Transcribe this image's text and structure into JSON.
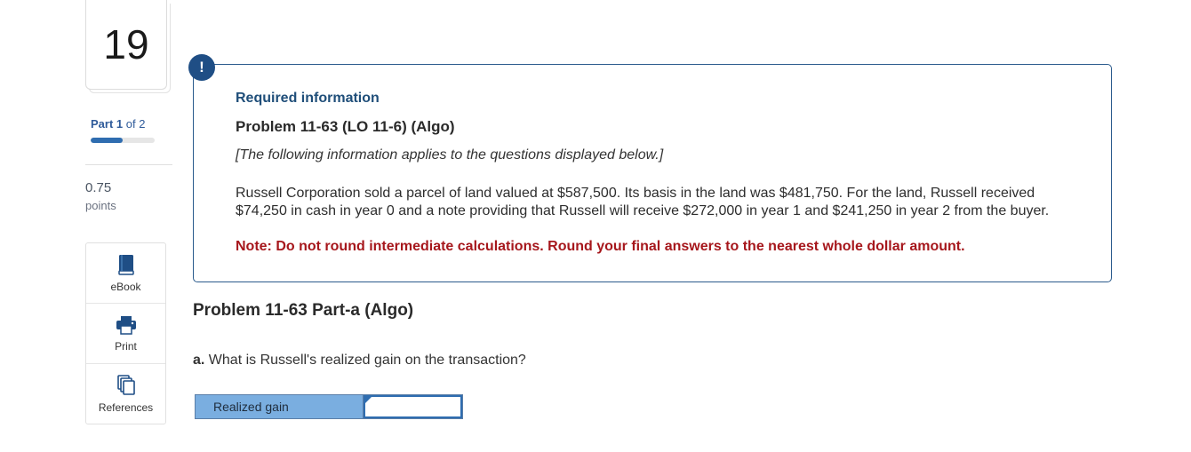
{
  "sidebar": {
    "question_number": "19",
    "part": {
      "prefix": "Part",
      "current": "1",
      "of_text": "of 2",
      "progress": 0.5
    },
    "points": {
      "value": "0.75",
      "label": "points"
    },
    "tools": [
      {
        "label": "eBook",
        "icon": "book-icon"
      },
      {
        "label": "Print",
        "icon": "printer-icon"
      },
      {
        "label": "References",
        "icon": "references-icon"
      }
    ]
  },
  "info": {
    "badge": "!",
    "required_title": "Required information",
    "problem_title": "Problem 11-63 (LO 11-6) (Algo)",
    "intro": "[The following information applies to the questions displayed below.]",
    "body": "Russell Corporation sold a parcel of land valued at $587,500. Its basis in the land was $481,750. For the land, Russell received $74,250 in cash in year 0 and a note providing that Russell will receive $272,000 in year 1 and $241,250 in year 2 from the buyer.",
    "note": "Note: Do not round intermediate calculations. Round your final answers to the nearest whole dollar amount."
  },
  "part_a": {
    "title": "Problem 11-63 Part-a (Algo)",
    "question_prefix": "a.",
    "question_text": "What is Russell's realized gain on the transaction?",
    "answer_label": "Realized gain",
    "answer_value": ""
  },
  "colors": {
    "accent_blue": "#1f4e85",
    "note_red": "#a6171c",
    "answer_label_bg": "#7aaee0"
  }
}
